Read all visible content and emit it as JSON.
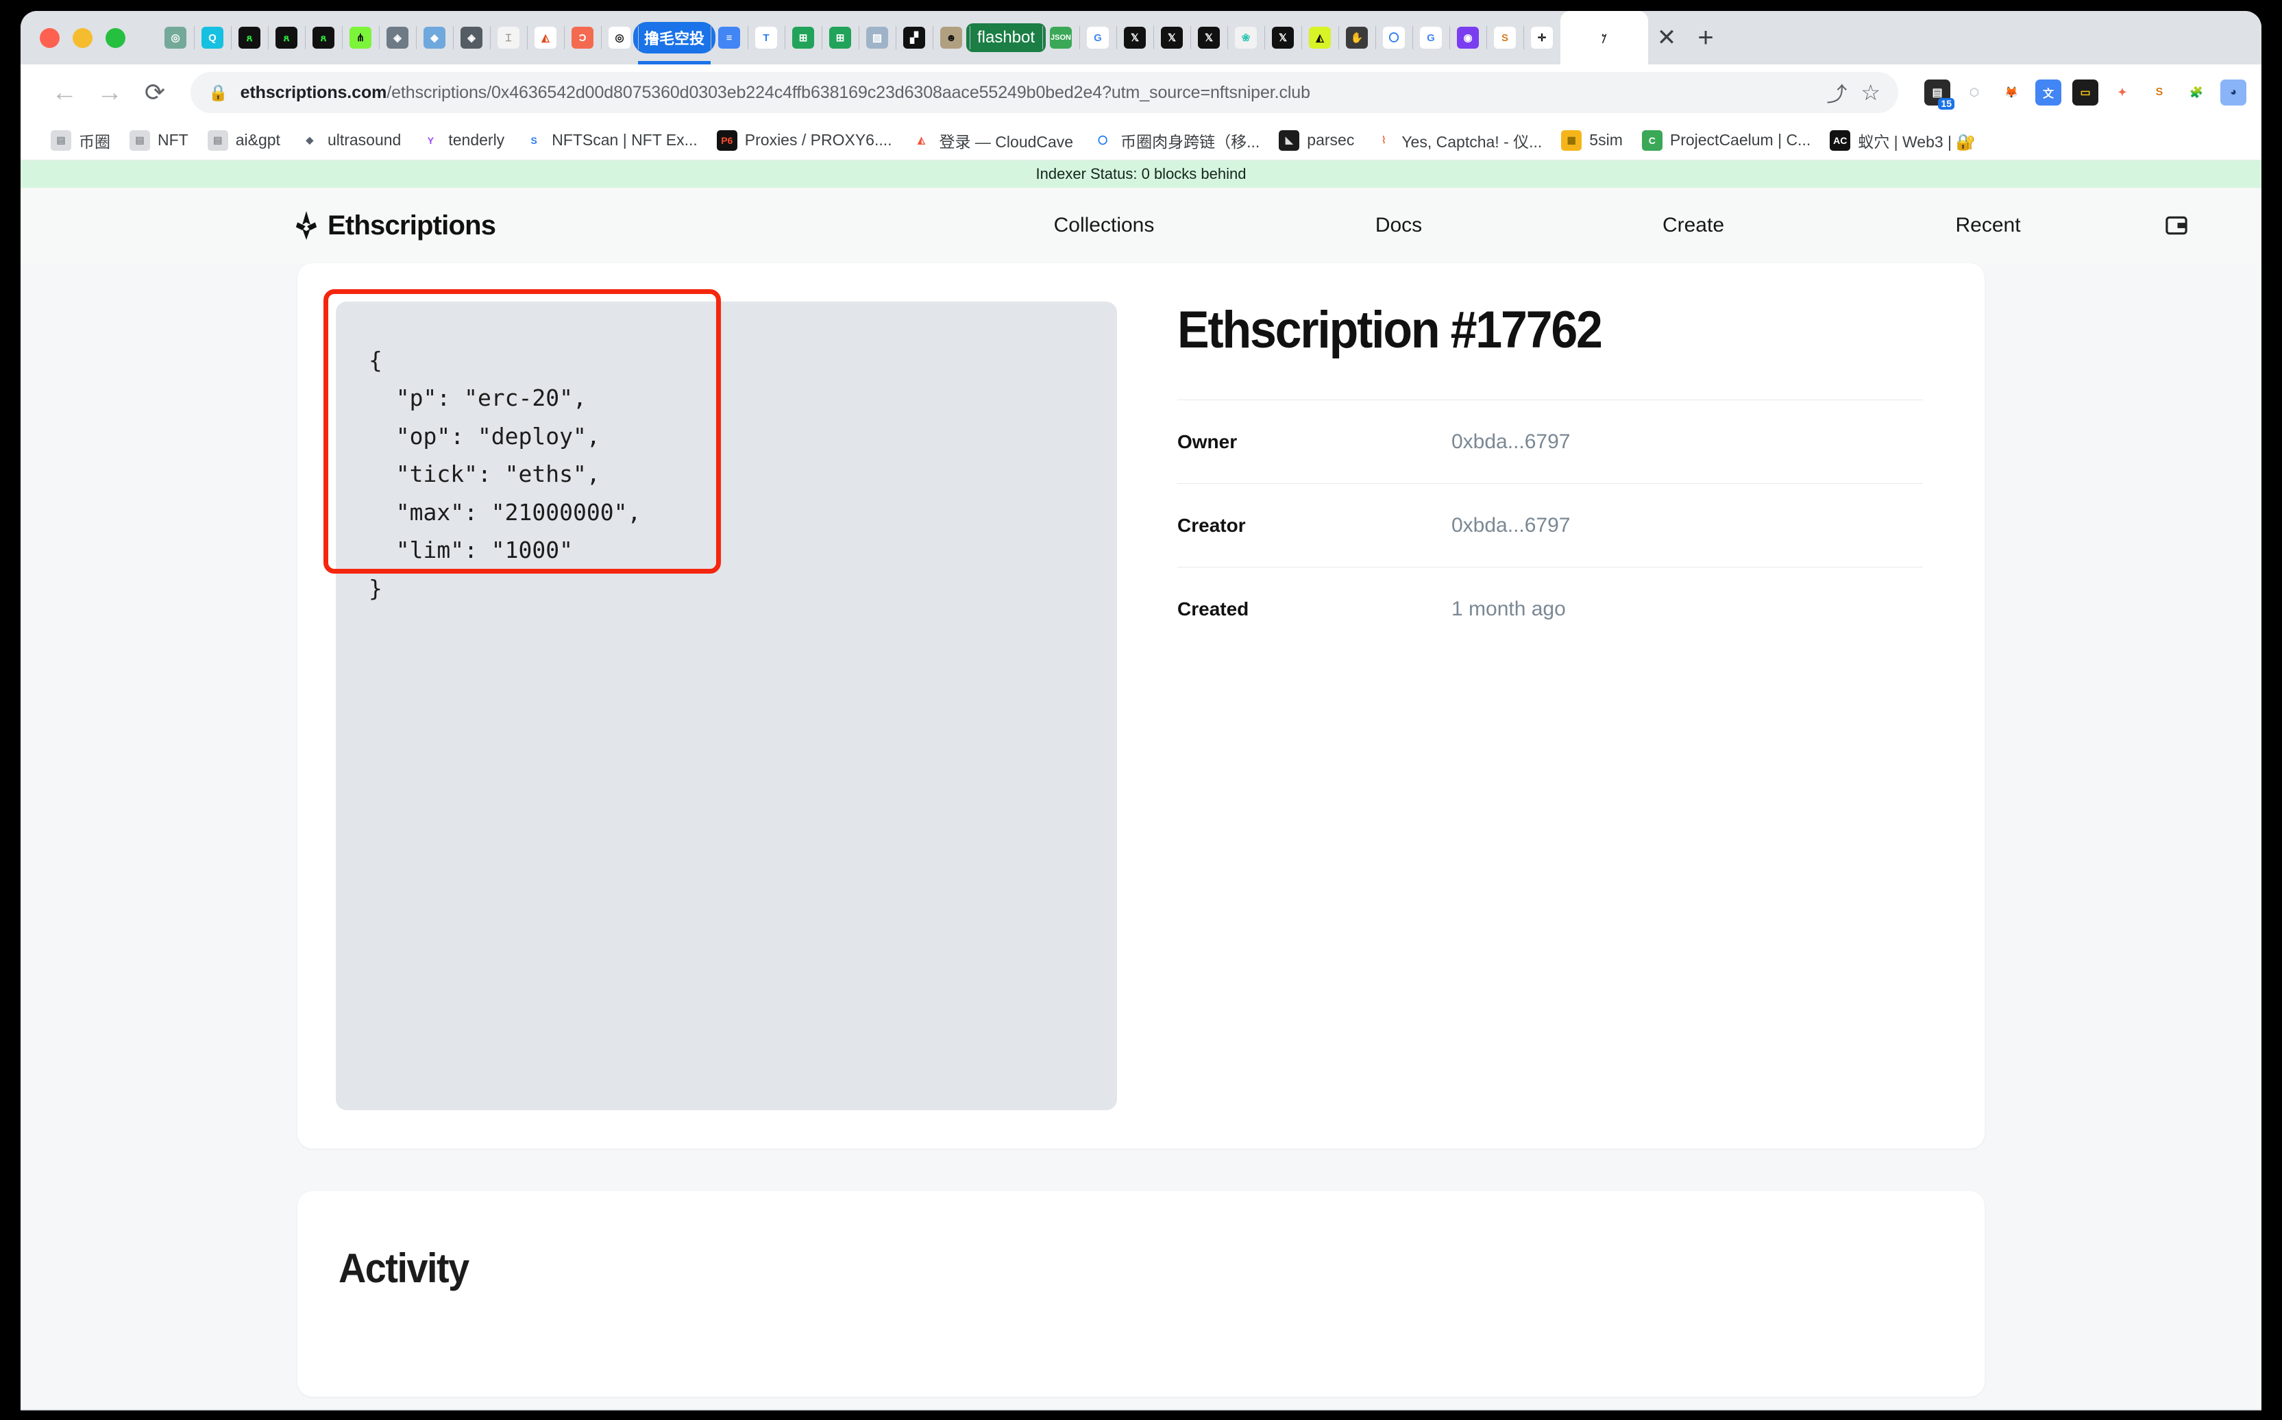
{
  "browser": {
    "window_controls": [
      "close",
      "minimize",
      "maximize"
    ],
    "tabs": [
      {
        "name": "openai-tab",
        "glyph": "◎",
        "bg": "#74a99a",
        "fg": "#ffffff"
      },
      {
        "name": "blue-app-tab",
        "glyph": "Q",
        "bg": "#16c0e0",
        "fg": "#ffffff"
      },
      {
        "name": "black-green-tab-1",
        "glyph": "ጸ",
        "bg": "#111111",
        "fg": "#2bf53a"
      },
      {
        "name": "black-green-tab-2",
        "glyph": "ጸ",
        "bg": "#111111",
        "fg": "#2bf53a"
      },
      {
        "name": "black-green-tab-3",
        "glyph": "ጸ",
        "bg": "#111111",
        "fg": "#2bf53a"
      },
      {
        "name": "green-circle-tab",
        "glyph": "⋔",
        "bg": "#7cf43a",
        "fg": "#111111"
      },
      {
        "name": "etherscan-tab-1",
        "glyph": "◈",
        "bg": "#6e7a86",
        "fg": "#ffffff"
      },
      {
        "name": "blue-gem-tab",
        "glyph": "◆",
        "bg": "#6fa8dc",
        "fg": "#ffffff"
      },
      {
        "name": "etherscan-tab-2",
        "glyph": "◈",
        "bg": "#545c64",
        "fg": "#ffffff"
      },
      {
        "name": "lamp-tab",
        "glyph": "⌶",
        "bg": "#f4f4f4",
        "fg": "#8a8172"
      },
      {
        "name": "flame-tab",
        "glyph": "◭",
        "bg": "#ffffff",
        "fg": "#e04a1a"
      },
      {
        "name": "orange-tab",
        "glyph": "Ɔ",
        "bg": "#f46a50",
        "fg": "#ffffff"
      },
      {
        "name": "spiral-tab",
        "glyph": "◎",
        "bg": "#ffffff",
        "fg": "#111111"
      },
      {
        "name": "airdrop-tab",
        "label": "撸毛空投",
        "pill": true,
        "active_underline": true
      },
      {
        "name": "google-docs-tab",
        "glyph": "≡",
        "bg": "#4285f4",
        "fg": "#ffffff"
      },
      {
        "name": "text-tab",
        "glyph": "T",
        "bg": "#ffffff",
        "fg": "#2b7cf3"
      },
      {
        "name": "sheets-tab-1",
        "glyph": "⊞",
        "bg": "#22a35a",
        "fg": "#ffffff"
      },
      {
        "name": "sheets-tab-2",
        "glyph": "⊞",
        "bg": "#22a35a",
        "fg": "#ffffff"
      },
      {
        "name": "photo-tab",
        "glyph": "▨",
        "bg": "#9fb3c8",
        "fg": "#ffffff"
      },
      {
        "name": "checker-tab",
        "glyph": "▞",
        "bg": "#111111",
        "fg": "#ffffff"
      },
      {
        "name": "panda-tab",
        "glyph": "☻",
        "bg": "#b0a080",
        "fg": "#111111"
      },
      {
        "name": "flashbot-tab",
        "label": "flashbot",
        "pill_green": true
      },
      {
        "name": "json-tab",
        "glyph": "JSON",
        "bg": "#3aa856",
        "fg": "#ffffff",
        "small": true
      },
      {
        "name": "google-tab-1",
        "glyph": "G",
        "bg": "#ffffff",
        "fg": "#4285f4"
      },
      {
        "name": "x-tab-1",
        "glyph": "𝕏",
        "bg": "#111111",
        "fg": "#ffffff"
      },
      {
        "name": "x-tab-2",
        "glyph": "𝕏",
        "bg": "#111111",
        "fg": "#ffffff"
      },
      {
        "name": "x-tab-3",
        "glyph": "𝕏",
        "bg": "#111111",
        "fg": "#ffffff"
      },
      {
        "name": "teal-tab",
        "glyph": "❀",
        "bg": "#f2f2f2",
        "fg": "#2ec7b4"
      },
      {
        "name": "x-tab-4",
        "glyph": "𝕏",
        "bg": "#111111",
        "fg": "#ffffff"
      },
      {
        "name": "yellow-eth-tab",
        "glyph": "◭",
        "bg": "#d8f326",
        "fg": "#111111"
      },
      {
        "name": "hand-tab",
        "glyph": "✋",
        "bg": "#3b3b3b",
        "fg": "#ffffff"
      },
      {
        "name": "blue-o-tab",
        "glyph": "〇",
        "bg": "#ffffff",
        "fg": "#1877f2"
      },
      {
        "name": "google-tab-2",
        "glyph": "G",
        "bg": "#ffffff",
        "fg": "#4285f4"
      },
      {
        "name": "purple-art-tab",
        "glyph": "◉",
        "bg": "#7a3df0",
        "fg": "#ffffff"
      },
      {
        "name": "s-tab",
        "glyph": "S",
        "bg": "#ffffff",
        "fg": "#d97a1a"
      },
      {
        "name": "target-tab",
        "glyph": "✛",
        "bg": "#ffffff",
        "fg": "#111111"
      },
      {
        "name": "ethscriptions-active-tab",
        "glyph": "𐤊",
        "active": true
      }
    ],
    "close_tab_label": "✕",
    "new_tab_label": "+",
    "toolbar": {
      "back_label": "←",
      "forward_label": "→",
      "reload_label": "⟳",
      "lock_icon": "🔒",
      "url_host": "ethscriptions.com",
      "url_path": "/ethscriptions/0x4636542d00d8075360d0303eb224c4ffb638169c23d6308aace55249b0bed2e4?utm_source=nftsniper.club",
      "share_label": "⤴",
      "bookmark_star_label": "☆",
      "extensions": [
        {
          "name": "notes-extension-icon",
          "glyph": "▤",
          "bg": "#2b2b2b",
          "fg": "#ffffff",
          "badge": "15"
        },
        {
          "name": "rabby-extension-icon",
          "glyph": "⬡",
          "bg": "#ffffff",
          "fg": "#c8ccd0"
        },
        {
          "name": "metamask-extension-icon",
          "glyph": "🦊",
          "bg": "#ffffff",
          "fg": "#e2761b"
        },
        {
          "name": "google-translate-extension-icon",
          "glyph": "文",
          "bg": "#4285f4",
          "fg": "#ffffff"
        },
        {
          "name": "card-extension-icon",
          "glyph": "▭",
          "bg": "#1c1c1c",
          "fg": "#f5c518"
        },
        {
          "name": "ai-extension-icon",
          "glyph": "✦",
          "bg": "#ffffff",
          "fg": "#f06a4a"
        },
        {
          "name": "snapshot-extension-icon",
          "glyph": "S",
          "bg": "#ffffff",
          "fg": "#d97a1a"
        },
        {
          "name": "puzzle-extensions-icon",
          "glyph": "🧩",
          "bg": "#ffffff",
          "fg": "#5f6368"
        },
        {
          "name": "profile-avatar-icon",
          "glyph": "◕",
          "bg": "#8ab4f8",
          "fg": "#1a3a6b"
        }
      ]
    },
    "bookmarks": [
      {
        "label": "币圈",
        "icon": "folder-icon",
        "glyph": "▤",
        "bg": "#dadce0",
        "fg": "#8a8d91"
      },
      {
        "label": "NFT",
        "icon": "folder-icon",
        "glyph": "▤",
        "bg": "#dadce0",
        "fg": "#8a8d91"
      },
      {
        "label": "ai&gpt",
        "icon": "folder-icon",
        "glyph": "▤",
        "bg": "#dadce0",
        "fg": "#8a8d91"
      },
      {
        "label": "ultrasound",
        "icon": "ethereum-icon",
        "glyph": "◆",
        "bg": "#ffffff",
        "fg": "#5b6270"
      },
      {
        "label": "tenderly",
        "icon": "tenderly-icon",
        "glyph": "Y",
        "bg": "#ffffff",
        "fg": "#9b4dff"
      },
      {
        "label": "NFTScan | NFT Ex...",
        "icon": "nftscan-icon",
        "glyph": "S",
        "bg": "#ffffff",
        "fg": "#2b7cf3"
      },
      {
        "label": "Proxies / PROXY6....",
        "icon": "proxy6-icon",
        "glyph": "P6",
        "bg": "#111111",
        "fg": "#ff4d2d"
      },
      {
        "label": "登录 — CloudCave",
        "icon": "cloudcave-icon",
        "glyph": "◭",
        "bg": "#ffffff",
        "fg": "#f0543a"
      },
      {
        "label": "币圈肉身跨链（移...",
        "icon": "blue-circle-icon",
        "glyph": "〇",
        "bg": "#ffffff",
        "fg": "#1877f2"
      },
      {
        "label": "parsec",
        "icon": "parsec-icon",
        "glyph": "◣",
        "bg": "#1c1c1c",
        "fg": "#dddddd"
      },
      {
        "label": "Yes, Captcha! - 仪...",
        "icon": "yescaptcha-icon",
        "glyph": "⌇",
        "bg": "#ffffff",
        "fg": "#f06a4a"
      },
      {
        "label": "5sim",
        "icon": "sim-card-icon",
        "glyph": "▦",
        "bg": "#f5b51a",
        "fg": "#8a6a00"
      },
      {
        "label": "ProjectCaelum | C...",
        "icon": "projectcaelum-icon",
        "glyph": "C",
        "bg": "#3aa856",
        "fg": "#ffffff"
      },
      {
        "label": "蚁穴 | Web3 | 🔐",
        "icon": "antnest-icon",
        "glyph": "AC",
        "bg": "#111111",
        "fg": "#ffffff"
      }
    ]
  },
  "site": {
    "indexer_status": "Indexer Status: 0 blocks behind",
    "brand": "Ethscriptions",
    "nav": [
      {
        "label": "Collections"
      },
      {
        "label": "Docs"
      },
      {
        "label": "Create"
      },
      {
        "label": "Recent"
      }
    ],
    "wallet_button_name": "wallet-icon"
  },
  "main": {
    "inscription_json": "{\n  \"p\": \"erc-20\",\n  \"op\": \"deploy\",\n  \"tick\": \"eths\",\n  \"max\": \"21000000\",\n  \"lim\": \"1000\"\n}",
    "title": "Ethscription #17762",
    "details": [
      {
        "label": "Owner",
        "value": "0xbda...6797"
      },
      {
        "label": "Creator",
        "value": "0xbda...6797"
      },
      {
        "label": "Created",
        "value": "1 month ago"
      }
    ],
    "highlight_color": "#f4260d"
  },
  "activity": {
    "title": "Activity"
  }
}
